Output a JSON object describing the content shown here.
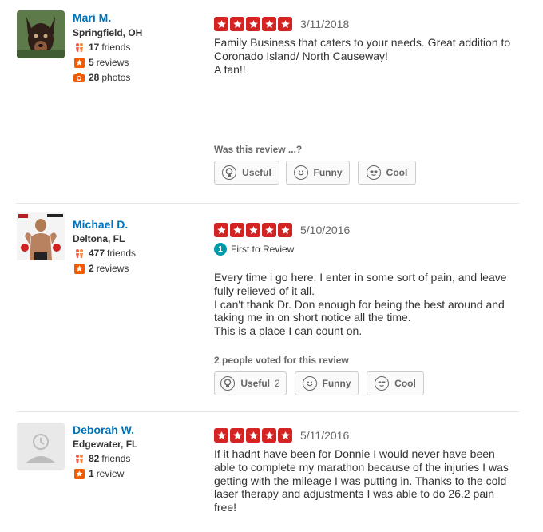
{
  "vote_labels": {
    "useful": "Useful",
    "funny": "Funny",
    "cool": "Cool"
  },
  "colors": {
    "star_red": "#d32323",
    "link_blue": "#0073bb",
    "badge_teal": "#0099a8"
  },
  "reviews": [
    {
      "user": {
        "name": "Mari M.",
        "location": "Springfield, OH",
        "friends": "17",
        "friends_label": "friends",
        "reviews": "5",
        "reviews_label": "reviews",
        "photos": "28",
        "photos_label": "photos",
        "avatar_icon": "dog-photo"
      },
      "rating": 5,
      "date": "3/11/2018",
      "text": "Family Business that caters to your needs.  Great addition to Coronado Island/ North Causeway!\nA fan!!",
      "vote_prompt": "Was this review ...?",
      "useful_count": ""
    },
    {
      "user": {
        "name": "Michael D.",
        "location": "Deltona, FL",
        "friends": "477",
        "friends_label": "friends",
        "reviews": "2",
        "reviews_label": "reviews",
        "avatar_icon": "fighter-photo"
      },
      "rating": 5,
      "date": "5/10/2016",
      "badge": "First to Review",
      "badge_number": "1",
      "text": "Every time i go here, I enter in some sort of pain, and leave fully relieved of it all.\nI can't thank Dr. Don enough for being the best around and taking me in on short notice all the time.\nThis is a place I can count on.",
      "vote_prompt": "2 people voted for this review",
      "useful_count": "2"
    },
    {
      "user": {
        "name": "Deborah W.",
        "location": "Edgewater, FL",
        "friends": "82",
        "friends_label": "friends",
        "reviews": "1",
        "reviews_label": "review",
        "avatar_icon": "default-user-icon"
      },
      "rating": 5,
      "date": "5/11/2016",
      "text": "If it hadnt have been for Donnie I would never have been able to complete my marathon because of the injuries I was getting with the mileage I was putting in. Thanks to the cold laser therapy and adjustments I was able to do 26.2 pain free!"
    }
  ]
}
